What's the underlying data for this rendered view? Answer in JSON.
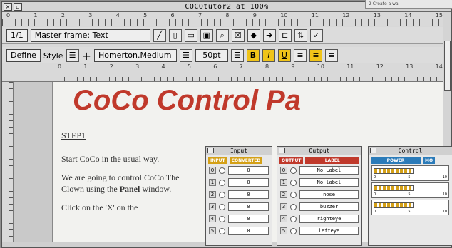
{
  "window": {
    "title": "COCOtutor2 at 100%"
  },
  "corner_note": "2 Create a wa",
  "ruler_top": {
    "numbers": [
      "0",
      "1",
      "2",
      "3",
      "4",
      "5",
      "6",
      "7",
      "8",
      "9",
      "10",
      "11",
      "12",
      "13",
      "14",
      "15"
    ]
  },
  "toolbar1": {
    "page_no": "1/1",
    "frame_label": "Master frame: Text"
  },
  "toolbar2": {
    "define_label": "Define",
    "style_label": "Style",
    "font_name": "Homerton.Medium",
    "font_size": "50pt",
    "bold": "B",
    "italic": "I",
    "underline": "U"
  },
  "ruler_text": {
    "numbers": [
      "0",
      "1",
      "2",
      "3",
      "4",
      "5",
      "6",
      "7",
      "8",
      "9",
      "10",
      "11",
      "12",
      "13",
      "14"
    ]
  },
  "document": {
    "headline": "CoCo Control Pa",
    "step": "STEP1",
    "para1": "Start CoCo in the usual way.",
    "para2_a": "We are going to control CoCo The Clown using the ",
    "para2_bold": "Panel",
    "para2_b": " window.",
    "para3": "Click on the 'X' on the"
  },
  "input_panel": {
    "title": "Input",
    "hdr1": "INPUT",
    "hdr2": "CONVERTED",
    "rows": [
      {
        "n": "0",
        "v": "0"
      },
      {
        "n": "1",
        "v": "0"
      },
      {
        "n": "2",
        "v": "0"
      },
      {
        "n": "3",
        "v": "0"
      },
      {
        "n": "4",
        "v": "0"
      },
      {
        "n": "5",
        "v": "0"
      }
    ]
  },
  "output_panel": {
    "title": "Output",
    "hdr1": "OUTPUT",
    "hdr2": "LABEL",
    "rows": [
      {
        "n": "0",
        "v": "No Label"
      },
      {
        "n": "1",
        "v": "No label"
      },
      {
        "n": "2",
        "v": "nose"
      },
      {
        "n": "3",
        "v": "buzzer"
      },
      {
        "n": "4",
        "v": "righteye"
      },
      {
        "n": "5",
        "v": "lefteye"
      }
    ]
  },
  "control_panel": {
    "title": "Control",
    "hdr1": "POWER",
    "hdr2": "MO",
    "scale": [
      "0",
      "5",
      "10"
    ]
  },
  "colors": {
    "headline": "#c0392b",
    "input_hdr": "#d4a017",
    "output_hdr": "#c0392b",
    "control_hdr": "#2b7bb9"
  }
}
